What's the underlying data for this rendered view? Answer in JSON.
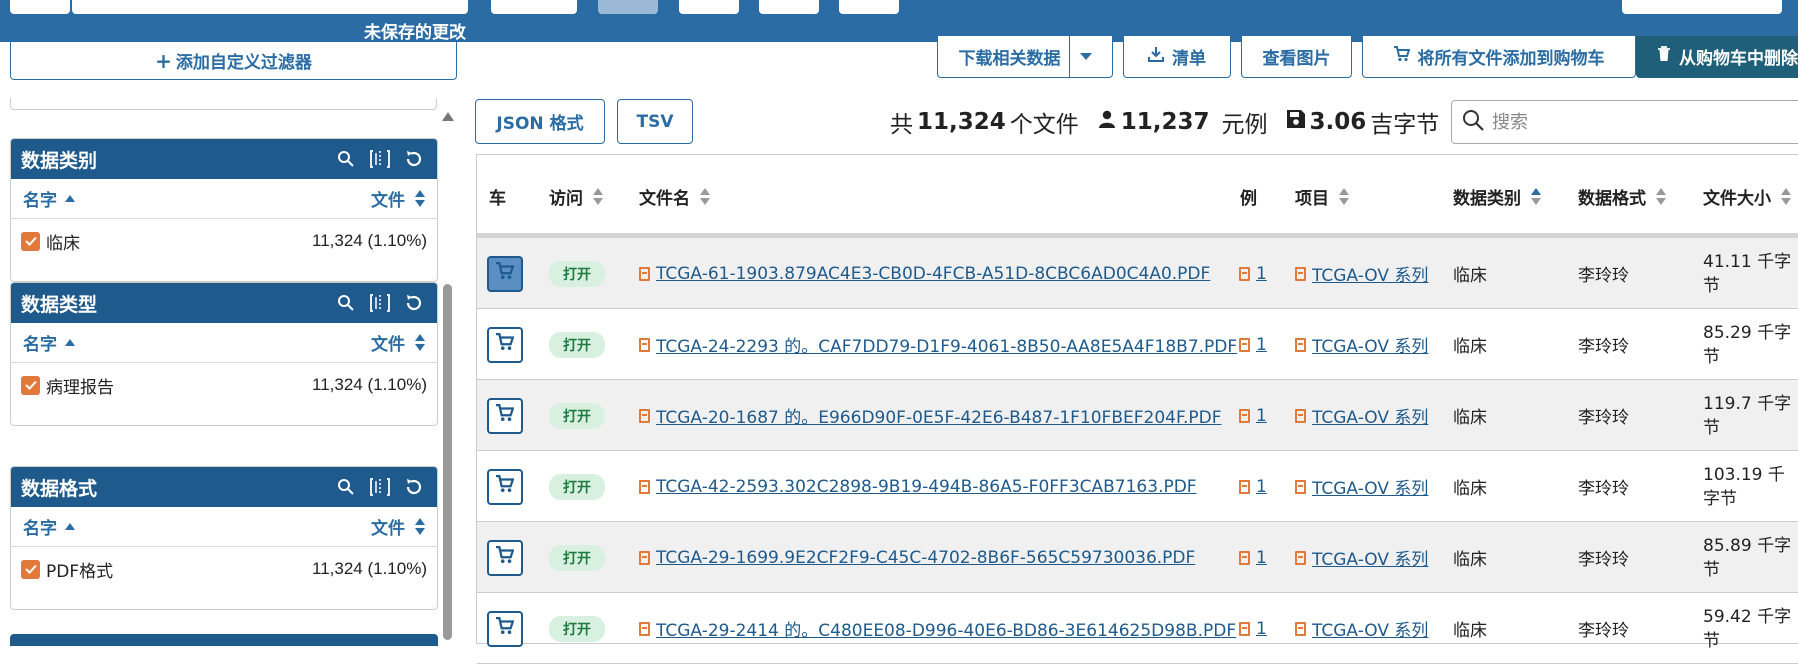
{
  "topbar": {
    "unsaved_label": "未保存的更改"
  },
  "left": {
    "add_filter_label": "添加自定义过滤器",
    "facets": [
      {
        "title": "数据类别",
        "col_name": "名字",
        "col_files": "文件",
        "value": "临床",
        "count": "11,324 (1.10%)"
      },
      {
        "title": "数据类型",
        "col_name": "名字",
        "col_files": "文件",
        "value": "病理报告",
        "count": "11,324 (1.10%)"
      },
      {
        "title": "数据格式",
        "col_name": "名字",
        "col_files": "文件",
        "value": "PDF格式",
        "count": "11,324 (1.10%)"
      }
    ]
  },
  "toolbar": {
    "download_label": "下载相关数据",
    "manifest_label": "清单",
    "view_images_label": "查看图片",
    "add_all_label": "将所有文件添加到购物车",
    "remove_label": "从购物车中删除"
  },
  "formats": {
    "json_label": "JSON 格式",
    "tsv_label": "TSV"
  },
  "summary": {
    "prefix": "共",
    "files_count": "11,324",
    "files_label": "个文件",
    "cases_count": "11,237",
    "cases_label": "元例",
    "size_value": "3.06",
    "size_unit": "吉字节"
  },
  "search": {
    "placeholder": "搜索"
  },
  "table": {
    "headers": {
      "cart": "车",
      "access": "访问",
      "filename": "文件名",
      "cases": "例",
      "project": "项目",
      "category": "数据类别",
      "format": "数据格式",
      "size": "文件大小"
    },
    "rows": [
      {
        "access": "打开",
        "filename": "TCGA-61-1903.879AC4E3-CB0D-4FCB-A51D-8CBC6AD0C4A0.PDF",
        "cases": "1",
        "project": "TCGA-OV 系列",
        "category": "临床",
        "format": "李玲玲",
        "size": "41.11 千字节",
        "in_cart": true
      },
      {
        "access": "打开",
        "filename": "TCGA-24-2293 的。CAF7DD79-D1F9-4061-8B50-AA8E5A4F18B7.PDF",
        "cases": "1",
        "project": "TCGA-OV 系列",
        "category": "临床",
        "format": "李玲玲",
        "size": "85.29 千字节",
        "in_cart": false
      },
      {
        "access": "打开",
        "filename": "TCGA-20-1687 的。E966D90F-0E5F-42E6-B487-1F10FBEF204F.PDF",
        "cases": "1",
        "project": "TCGA-OV 系列",
        "category": "临床",
        "format": "李玲玲",
        "size": "119.7 千字节",
        "in_cart": false
      },
      {
        "access": "打开",
        "filename": "TCGA-42-2593.302C2898-9B19-494B-86A5-F0FF3CAB7163.PDF",
        "cases": "1",
        "project": "TCGA-OV 系列",
        "category": "临床",
        "format": "李玲玲",
        "size": "103.19 千字节",
        "in_cart": false
      },
      {
        "access": "打开",
        "filename": "TCGA-29-1699.9E2CF2F9-C45C-4702-8B6F-565C59730036.PDF",
        "cases": "1",
        "project": "TCGA-OV 系列",
        "category": "临床",
        "format": "李玲玲",
        "size": "85.89 千字节",
        "in_cart": false
      },
      {
        "access": "打开",
        "filename": "TCGA-29-2414 的。C480EE08-D996-40E6-BD86-3E614625D98B.PDF",
        "cases": "1",
        "project": "TCGA-OV 系列",
        "category": "临床",
        "format": "李玲玲",
        "size": "59.42 千字节",
        "in_cart": false
      }
    ]
  }
}
